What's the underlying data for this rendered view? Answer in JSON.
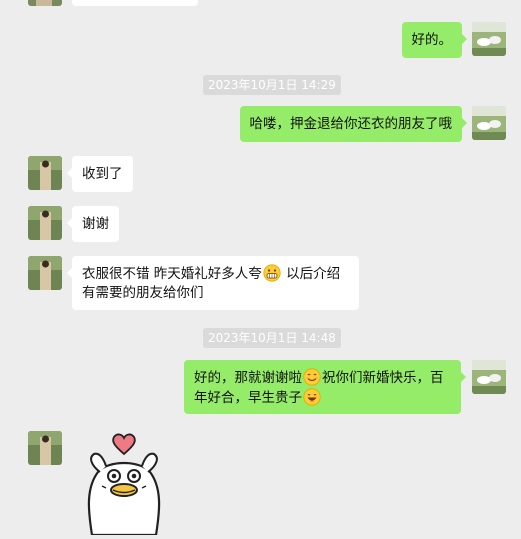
{
  "conversation": {
    "timestamps": [
      "2023年10月1日 14:29",
      "2023年10月1日 14:48"
    ],
    "messages": [
      {
        "id": "m1",
        "side": "out",
        "text": "好的。"
      },
      {
        "id": "m2",
        "side": "out",
        "text": "哈喽，押金退给你还衣的朋友了哦"
      },
      {
        "id": "m3",
        "side": "in",
        "text": "收到了"
      },
      {
        "id": "m4",
        "side": "in",
        "text": "谢谢"
      },
      {
        "id": "m5",
        "side": "in",
        "text_before_emoji": "衣服很不错 昨天婚礼好多人夸",
        "emoji": "grin-emoji",
        "text_after_emoji": " 以后介绍",
        "text_line2": "有需要的朋友给你们"
      },
      {
        "id": "m6",
        "side": "out",
        "text_part1": "好的，那就谢谢啦",
        "emoji1": "smile-emoji",
        "text_part2": "祝你们新婚快乐，百",
        "text_line2": "年好合，早生贵子",
        "emoji2": "happy-emoji"
      },
      {
        "id": "m7",
        "side": "in",
        "sticker": "duck-heart-sticker"
      }
    ]
  },
  "colors": {
    "background": "#EDEDED",
    "incoming_bubble": "#FFFFFF",
    "outgoing_bubble": "#95EC69",
    "timestamp_bg": "#DADADA"
  }
}
